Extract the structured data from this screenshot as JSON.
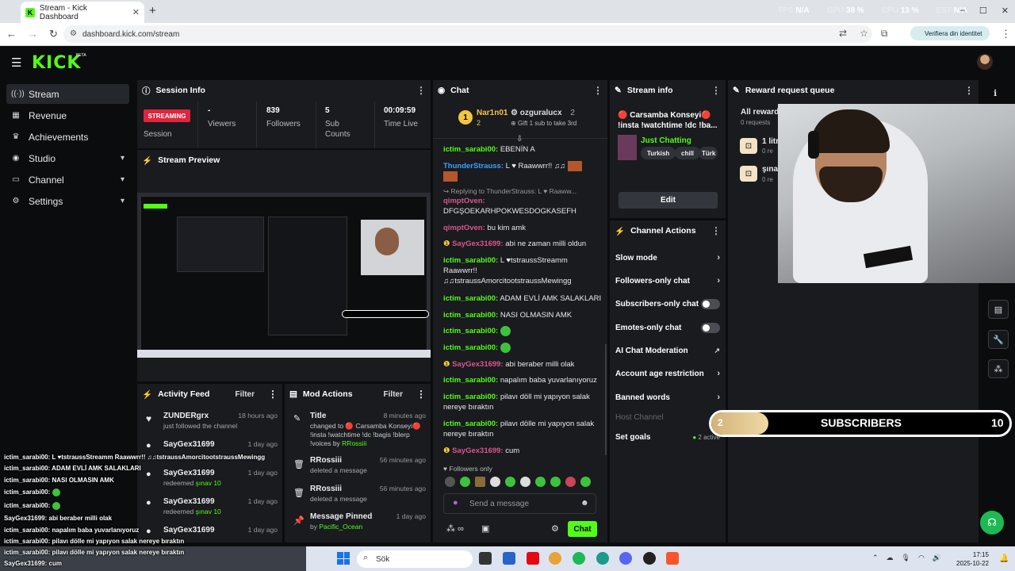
{
  "browser": {
    "tab_title": "Stream - Kick Dashboard",
    "url": "dashboard.kick.com/stream",
    "verify_label": "Verifiera din identitet",
    "perf": [
      {
        "k": "FPS",
        "v": "N/A"
      },
      {
        "k": "GPU",
        "v": "38 %"
      },
      {
        "k": "CPU",
        "v": "13 %"
      },
      {
        "k": "EST",
        "v": "N/A"
      }
    ]
  },
  "header": {
    "logo": "KICK",
    "beta": "BETA"
  },
  "sidebar": {
    "items": [
      {
        "label": "Stream",
        "icon": "radio-icon"
      },
      {
        "label": "Revenue",
        "icon": "revenue-icon"
      },
      {
        "label": "Achievements",
        "icon": "trophy-icon"
      },
      {
        "label": "Studio",
        "icon": "studio-icon"
      },
      {
        "label": "Channel",
        "icon": "channel-icon"
      },
      {
        "label": "Settings",
        "icon": "gear-icon"
      }
    ]
  },
  "session": {
    "title": "Session Info",
    "status": "STREAMING",
    "status_label": "Session",
    "viewers_v": "-",
    "viewers_l": "Viewers",
    "followers_v": "839",
    "followers_l": "Followers",
    "subs_v": "5",
    "subs_l": "Sub Counts",
    "time_v": "00:09:59",
    "time_l": "Time Live"
  },
  "preview": {
    "title": "Stream Preview"
  },
  "activity": {
    "title": "Activity Feed",
    "filter": "Filter",
    "items": [
      {
        "name": "ZUNDERgrx",
        "sub": "just followed the channel",
        "time": "18 hours ago"
      },
      {
        "name": "SayGex31699",
        "sub": "",
        "time": "1 day ago"
      },
      {
        "name": "SayGex31699",
        "sub": "redeemed",
        "extra": "şınav 10",
        "time": "1 day ago"
      },
      {
        "name": "SayGex31699",
        "sub": "redeemed",
        "extra": "şınav 10",
        "time": "1 day ago"
      },
      {
        "name": "SayGex31699",
        "sub": "",
        "time": "1 day ago"
      }
    ]
  },
  "mod": {
    "title": "Mod Actions",
    "filter": "Filter",
    "items": [
      {
        "name": "Title",
        "sub": "changed to 🔴 Carsamba Konseyi🔴 !insta !watchtime !dc !bagis !blerp !voices by",
        "by": "RRossiii",
        "time": "8 minutes ago"
      },
      {
        "name": "RRossiii",
        "sub": "deleted a message",
        "time": "56 minutes ago"
      },
      {
        "name": "RRossiii",
        "sub": "deleted a message",
        "time": "56 minutes ago"
      },
      {
        "name": "Message Pinned",
        "sub": "by",
        "by": "Pacific_Ocean",
        "time": "1 day ago"
      }
    ]
  },
  "chat": {
    "title": "Chat",
    "pin_user1": "Nar1n01",
    "pin_n1": "2",
    "pin_user2": "ozguralucx",
    "pin_n2": "2",
    "pin_gift": "Gift 1 sub to take 3rd",
    "followers_only": "Followers only",
    "placeholder": "Send a message",
    "send": "Chat",
    "messages": [
      {
        "u": "ictim_sarabi00:",
        "c": "g",
        "t": "EBENİN A"
      },
      {
        "u": "ThunderStrauss:",
        "c": "b",
        "t": "L ♥ Raawwrr!! ♫♫"
      },
      {
        "u": "",
        "c": "",
        "t": "↪ Replying to ThunderStrauss: L ♥ Raaww..."
      },
      {
        "u": "qimptOven:",
        "c": "p",
        "t": "DFGŞOEKARHPOKWESDOGKASEFH"
      },
      {
        "u": "qimptOven:",
        "c": "p",
        "t": "bu kim amk"
      },
      {
        "u": "SayGex31699:",
        "c": "p",
        "t": "abi ne zaman milli oldun"
      },
      {
        "u": "ictim_sarabi00:",
        "c": "g",
        "t": "L ♥tstraussStreamm Raawwrr!! ♫♫tstraussAmorcitootstraussMewingg"
      },
      {
        "u": "ictim_sarabi00:",
        "c": "g",
        "t": "ADAM EVLİ AMK SALAKLARI"
      },
      {
        "u": "ictim_sarabi00:",
        "c": "g",
        "t": "NASI OLMASIN AMK"
      },
      {
        "u": "ictim_sarabi00:",
        "c": "g",
        "t": ""
      },
      {
        "u": "ictim_sarabi00:",
        "c": "g",
        "t": ""
      },
      {
        "u": "SayGex31699:",
        "c": "p",
        "t": "abi beraber milli olak"
      },
      {
        "u": "ictim_sarabi00:",
        "c": "g",
        "t": "napalım baba yuvarlanıyoruz"
      },
      {
        "u": "ictim_sarabi00:",
        "c": "g",
        "t": "pilavı döll mi yapıyon salak nereye bıraktın"
      },
      {
        "u": "ictim_sarabi00:",
        "c": "g",
        "t": "pilavı dölle mi yapıyon salak nereye bıraktın"
      },
      {
        "u": "SayGex31699:",
        "c": "p",
        "t": "cum"
      }
    ]
  },
  "streaminfo": {
    "title": "Stream info",
    "stream_title": "🔴 Carsamba Konseyi🔴 !insta !watchtime !dc !ba...",
    "category": "Just Chatting",
    "tags": [
      "Turkish",
      "chill",
      "Türk"
    ],
    "edit": "Edit"
  },
  "channelactions": {
    "title": "Channel Actions",
    "items": [
      {
        "label": "Slow mode",
        "kind": "chevron"
      },
      {
        "label": "Followers-only chat",
        "kind": "chevron"
      },
      {
        "label": "Subscribers-only chat",
        "kind": "toggle"
      },
      {
        "label": "Emotes-only chat",
        "kind": "toggle"
      },
      {
        "label": "AI Chat Moderation",
        "kind": "ext"
      },
      {
        "label": "Account age restriction",
        "kind": "chevron"
      },
      {
        "label": "Banned words",
        "kind": "chevron"
      },
      {
        "label": "Host Channel",
        "kind": "none"
      },
      {
        "label": "Set goals",
        "kind": "chevron",
        "extra": "2 active"
      }
    ]
  },
  "reward": {
    "title": "Reward request queue",
    "all": "All reward",
    "count": "0 requests",
    "r1": "1 litr",
    "r1s": "0 re",
    "r2": "şına",
    "r2s": "0 re"
  },
  "subwidget": {
    "current": "2",
    "label": "SUBSCRIBERS",
    "goal": "10",
    "progress_fraction": 0.2
  },
  "overlay_chat": [
    {
      "u": "ictim_sarabi00",
      "t": ": L ♥tstraussStreamm Raawwrr!! ♫♫tstraussAmorcitootstraussMewingg"
    },
    {
      "u": "ictim_sarabi00",
      "t": ": ADAM EVLİ AMK SALAKLARI"
    },
    {
      "u": "ictim_sarabi00",
      "t": ": NASI OLMASIN AMK"
    },
    {
      "u": "ictim_sarabi00",
      "t": ":"
    },
    {
      "u": "ictim_sarabi00",
      "t": ":"
    },
    {
      "u": "SayGex31699",
      "t": ": abi beraber milli olak"
    },
    {
      "u": "ictim_sarabi00",
      "t": ": napalım baba yuvarlanıyoruz"
    },
    {
      "u": "ictim_sarabi00",
      "t": ": pilavı dölle mi yapıyon salak nereye bıraktın"
    },
    {
      "u": "ictim_sarabi00",
      "t": ": pilavı dölle mi yapıyon salak nereye bıraktın"
    },
    {
      "u": "SayGex31699",
      "t": ": cum"
    }
  ],
  "taskbar": {
    "search": "Sök",
    "time": "17:15",
    "date": "2025-10-22"
  }
}
